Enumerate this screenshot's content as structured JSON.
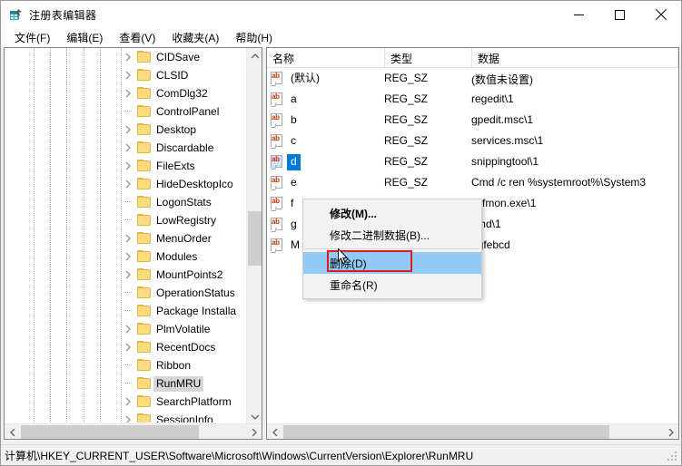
{
  "window": {
    "title": "注册表编辑器",
    "icon": "registry-editor-icon",
    "minimize_label": "−",
    "maximize_label": "□",
    "close_label": "×"
  },
  "menubar": {
    "items": [
      {
        "label": "文件(F)",
        "name": "menu-file"
      },
      {
        "label": "编辑(E)",
        "name": "menu-edit"
      },
      {
        "label": "查看(V)",
        "name": "menu-view"
      },
      {
        "label": "收藏夹(A)",
        "name": "menu-favorites"
      },
      {
        "label": "帮助(H)",
        "name": "menu-help"
      }
    ]
  },
  "tree": {
    "items": [
      {
        "label": "CIDSave",
        "expandable": true,
        "indent": 7,
        "selected": false
      },
      {
        "label": "CLSID",
        "expandable": true,
        "indent": 7,
        "selected": false
      },
      {
        "label": "ComDlg32",
        "expandable": true,
        "indent": 7,
        "selected": false
      },
      {
        "label": "ControlPanel",
        "expandable": false,
        "indent": 7,
        "selected": false
      },
      {
        "label": "Desktop",
        "expandable": true,
        "indent": 7,
        "selected": false
      },
      {
        "label": "Discardable",
        "expandable": true,
        "indent": 7,
        "selected": false
      },
      {
        "label": "FileExts",
        "expandable": true,
        "indent": 7,
        "selected": false
      },
      {
        "label": "HideDesktopIco",
        "expandable": true,
        "indent": 7,
        "selected": false
      },
      {
        "label": "LogonStats",
        "expandable": false,
        "indent": 7,
        "selected": false
      },
      {
        "label": "LowRegistry",
        "expandable": false,
        "indent": 7,
        "selected": false
      },
      {
        "label": "MenuOrder",
        "expandable": true,
        "indent": 7,
        "selected": false
      },
      {
        "label": "Modules",
        "expandable": true,
        "indent": 7,
        "selected": false
      },
      {
        "label": "MountPoints2",
        "expandable": true,
        "indent": 7,
        "selected": false
      },
      {
        "label": "OperationStatus",
        "expandable": false,
        "indent": 7,
        "selected": false
      },
      {
        "label": "Package Installa",
        "expandable": false,
        "indent": 7,
        "selected": false
      },
      {
        "label": "PlmVolatile",
        "expandable": true,
        "indent": 7,
        "selected": false
      },
      {
        "label": "RecentDocs",
        "expandable": true,
        "indent": 7,
        "selected": false
      },
      {
        "label": "Ribbon",
        "expandable": false,
        "indent": 7,
        "selected": false
      },
      {
        "label": "RunMRU",
        "expandable": false,
        "indent": 7,
        "selected": true
      },
      {
        "label": "SearchPlatform",
        "expandable": true,
        "indent": 7,
        "selected": false
      },
      {
        "label": "SessionInfo",
        "expandable": true,
        "indent": 7,
        "selected": false
      }
    ]
  },
  "list": {
    "columns": [
      {
        "label": "名称",
        "name": "column-name"
      },
      {
        "label": "类型",
        "name": "column-type"
      },
      {
        "label": "数据",
        "name": "column-data"
      }
    ],
    "rows": [
      {
        "name": "(默认)",
        "type": "REG_SZ",
        "data": "(数值未设置)",
        "selected": false
      },
      {
        "name": "a",
        "type": "REG_SZ",
        "data": "regedit\\1",
        "selected": false
      },
      {
        "name": "b",
        "type": "REG_SZ",
        "data": "gpedit.msc\\1",
        "selected": false
      },
      {
        "name": "c",
        "type": "REG_SZ",
        "data": "services.msc\\1",
        "selected": false
      },
      {
        "name": "d",
        "type": "REG_SZ",
        "data": "snippingtool\\1",
        "selected": true
      },
      {
        "name": "e",
        "type": "REG_SZ",
        "data": "Cmd /c ren %systemroot%\\System3",
        "selected": false
      },
      {
        "name": "f",
        "type": "REG_SZ",
        "data": "Ctfmon.exe\\1",
        "selected": false
      },
      {
        "name": "g",
        "type": "REG_SZ",
        "data": "cmd\\1",
        "selected": false
      },
      {
        "name": "M",
        "type": "REG_SZ",
        "data": "agfebcd",
        "selected": false
      }
    ]
  },
  "context_menu": {
    "items": [
      {
        "label": "修改(M)...",
        "name": "context-modify",
        "bold": true,
        "highlighted": false,
        "separator_after": false
      },
      {
        "label": "修改二进制数据(B)...",
        "name": "context-modify-binary",
        "bold": false,
        "highlighted": false,
        "separator_after": true
      },
      {
        "label": "删除(D)",
        "name": "context-delete",
        "bold": false,
        "highlighted": true,
        "separator_after": false
      },
      {
        "label": "重命名(R)",
        "name": "context-rename",
        "bold": false,
        "highlighted": false,
        "separator_after": false
      }
    ],
    "highlight_color": "#91c9f7",
    "annotation_color": "#e01b1b"
  },
  "statusbar": {
    "path": "计算机\\HKEY_CURRENT_USER\\Software\\Microsoft\\Windows\\CurrentVersion\\Explorer\\RunMRU"
  },
  "colors": {
    "selection_blue": "#0078d7",
    "folder_yellow": "#fdd97f",
    "tree_selected_gray": "#d6d6d6"
  }
}
